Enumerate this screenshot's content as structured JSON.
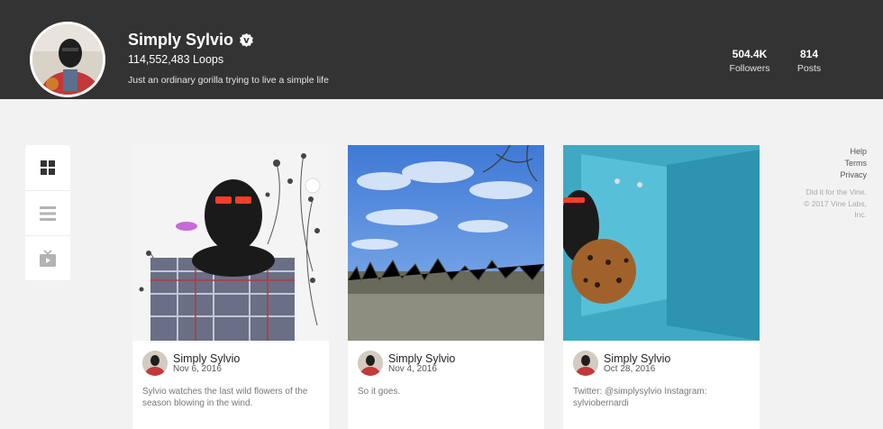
{
  "profile": {
    "name": "Simply Sylvio",
    "loops": "114,552,483 Loops",
    "bio": "Just an ordinary gorilla trying to live a simple life",
    "verified_icon": "vine-verified-icon"
  },
  "stats": {
    "followers": {
      "value": "504.4K",
      "label": "Followers"
    },
    "posts": {
      "value": "814",
      "label": "Posts"
    }
  },
  "view_switcher": [
    {
      "icon": "grid-icon"
    },
    {
      "icon": "list-icon"
    },
    {
      "icon": "tv-icon"
    }
  ],
  "posts": [
    {
      "author": "Simply Sylvio",
      "date": "Nov 6, 2016",
      "caption": "Sylvio watches the last wild flowers of the season blowing in the wind."
    },
    {
      "author": "Simply Sylvio",
      "date": "Nov 4, 2016",
      "caption": "So it goes."
    },
    {
      "author": "Simply Sylvio",
      "date": "Oct 28, 2016",
      "caption": "Twitter: @simplysylvio Instagram: sylviobernardi"
    }
  ],
  "side_links": {
    "help": "Help",
    "terms": "Terms",
    "privacy": "Privacy",
    "copyright": "Did it for the Vine. © 2017 Vine Labs, Inc."
  },
  "colors": {
    "header_bg": "#333333",
    "page_bg": "#f2f2f2",
    "verified": "#ffffff"
  }
}
